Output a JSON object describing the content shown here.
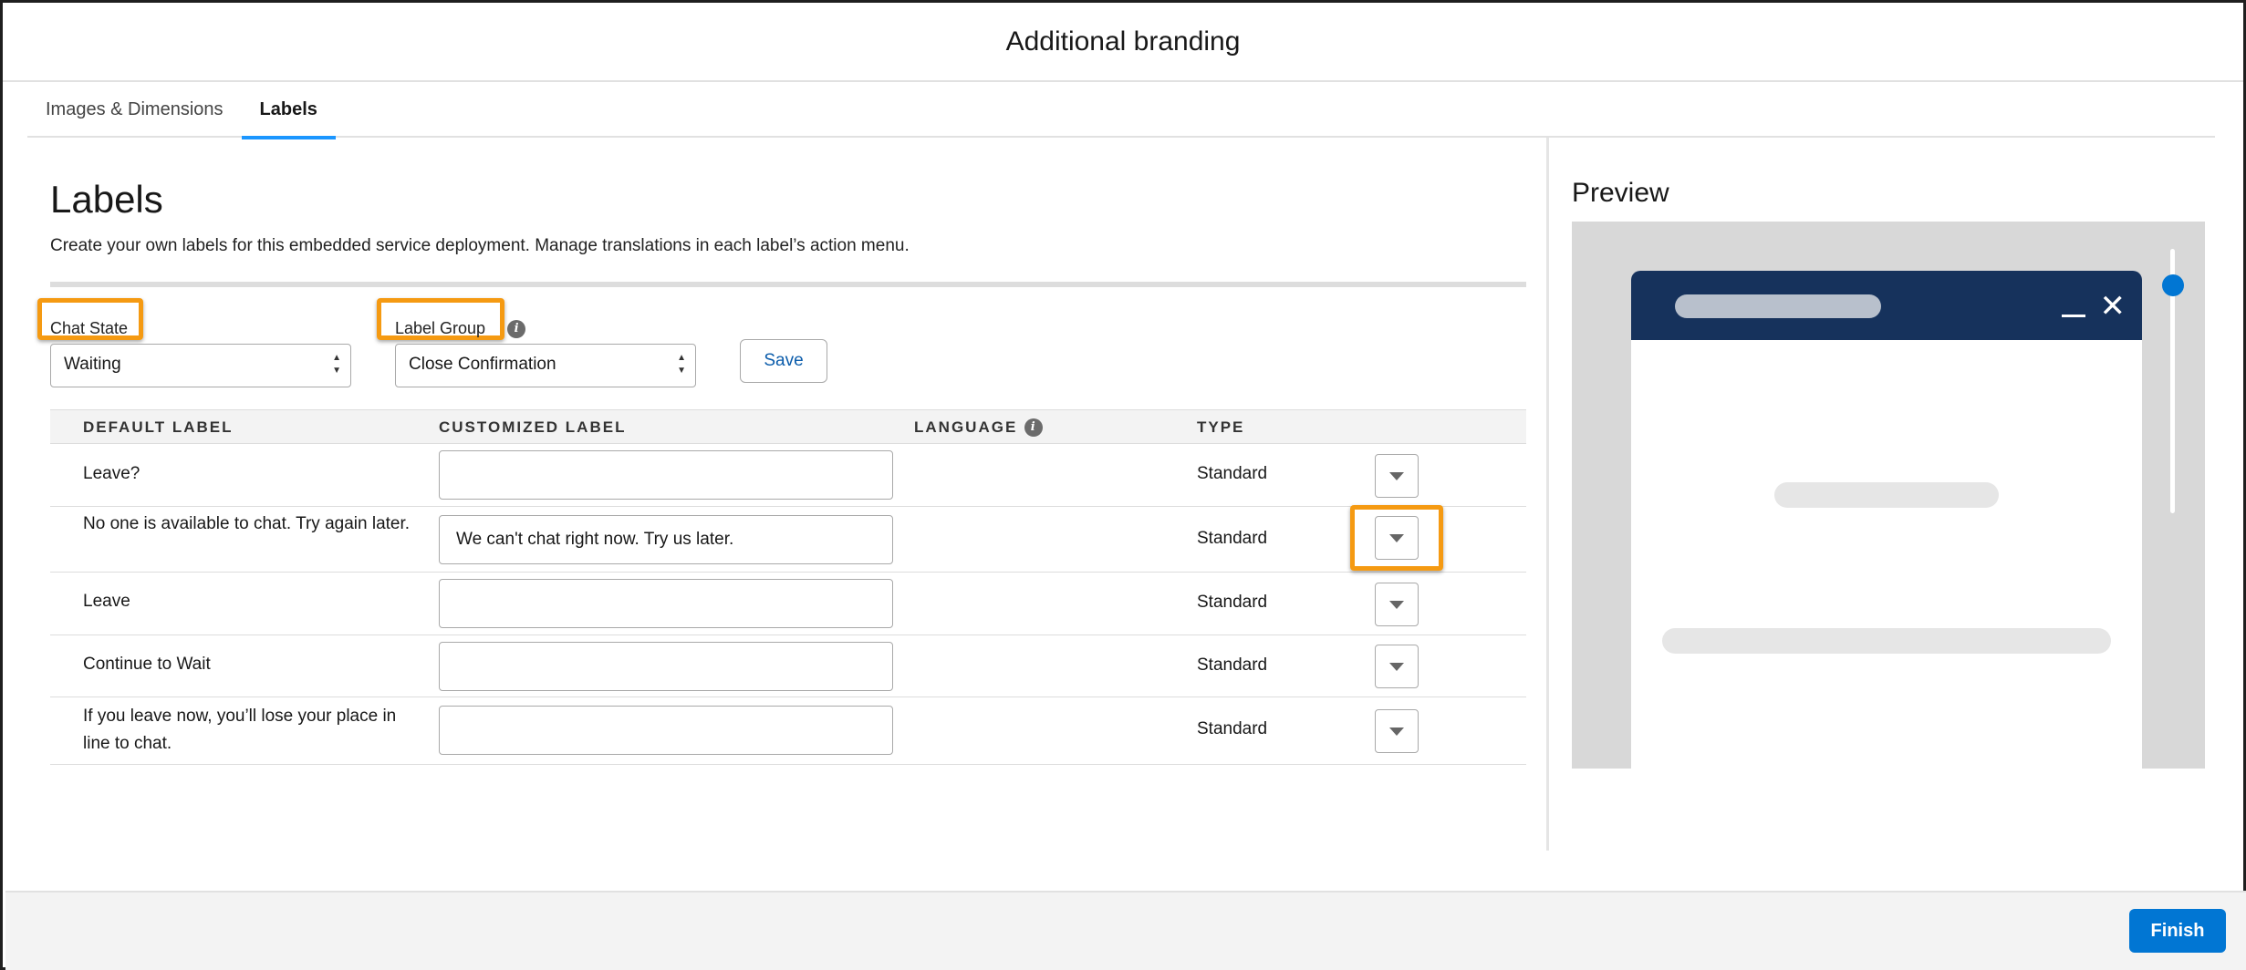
{
  "window": {
    "title": "Additional branding"
  },
  "tabs": [
    {
      "label": "Images & Dimensions",
      "active": false
    },
    {
      "label": "Labels",
      "active": true
    }
  ],
  "labels_section": {
    "title": "Labels",
    "description": "Create your own labels for this embedded service deployment. Manage translations in each label’s action menu."
  },
  "filters": {
    "chat_state": {
      "label": "Chat State",
      "value": "Waiting"
    },
    "label_group": {
      "label": "Label Group",
      "value": "Close Confirmation"
    },
    "save_label": "Save"
  },
  "table": {
    "headers": {
      "default_label": "DEFAULT LABEL",
      "customized_label": "CUSTOMIZED LABEL",
      "language": "LANGUAGE",
      "type": "TYPE"
    },
    "rows": [
      {
        "default_label": "Leave?",
        "customized_label": "",
        "type": "Standard"
      },
      {
        "default_label": "No one is available to chat. Try again later.",
        "customized_label": "We can't chat right now. Try us later.",
        "type": "Standard"
      },
      {
        "default_label": "Leave",
        "customized_label": "",
        "type": "Standard"
      },
      {
        "default_label": "Continue to Wait",
        "customized_label": "",
        "type": "Standard"
      },
      {
        "default_label": "If you leave now, you’ll lose your place in line to chat.",
        "customized_label": "",
        "type": "Standard"
      }
    ]
  },
  "preview": {
    "title": "Preview"
  },
  "footer": {
    "finish_label": "Finish"
  },
  "colors": {
    "accent": "#0176d3",
    "highlight": "#f59a12",
    "chat_header": "#16325c"
  },
  "icons": [
    "info-icon",
    "chevron-down-icon",
    "minimize-icon",
    "close-icon",
    "select-arrows-icon"
  ]
}
